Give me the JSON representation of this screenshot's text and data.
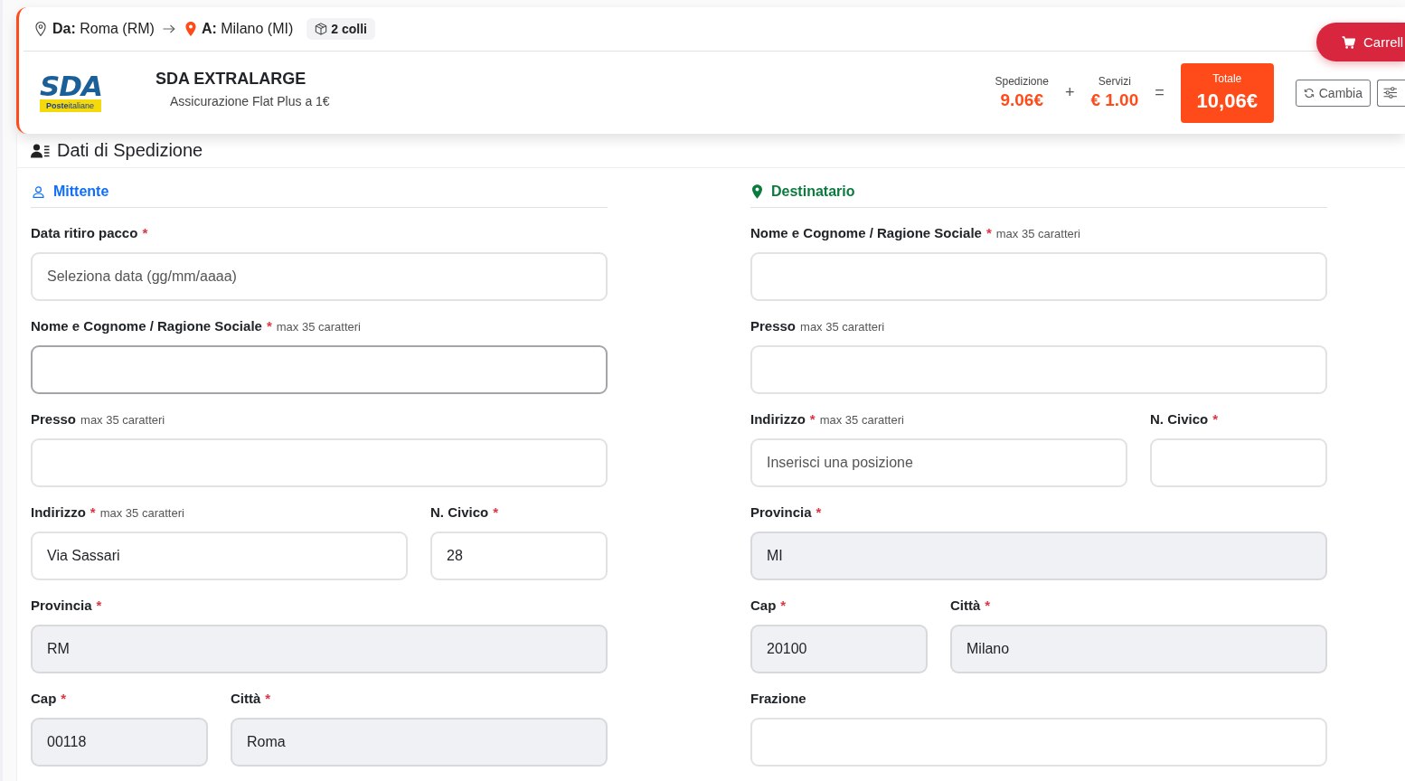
{
  "route": {
    "from": "**Da:** Roma (RM)",
    "to": "**A:** Milano (MI)",
    "packages": "2 colli"
  },
  "cart_button": {
    "label": "Carrell"
  },
  "carrier": {
    "logo": {
      "wordmark": "SDA",
      "tagline": "**Poste**italiane"
    },
    "service": "SDA EXTRALARGE",
    "option": "Assicurazione Flat Plus a 1€"
  },
  "price": {
    "items": [
      {
        "label": "Spedizione",
        "value": "9.06€"
      },
      {
        "label": "Servizi",
        "value": "€ 1.00"
      }
    ],
    "operators": [
      "+",
      "="
    ],
    "total": {
      "label": "Totale",
      "value": "10,06€"
    }
  },
  "actions": [
    {
      "kind": "change",
      "label": "Cambia"
    },
    {
      "kind": "options"
    }
  ],
  "section": {
    "title": "Dati di Spedizione"
  },
  "columns": [
    {
      "kind": "sender",
      "title": "Mittente",
      "color": "#0d6efd",
      "rows": [
        {
          "kind": "single",
          "fields": [
            {
              "label": "Data ritiro pacco",
              "required_mark": "*",
              "placeholder": "Seleziona data (gg/mm/aaaa)",
              "readonly": false,
              "focused": false
            }
          ]
        },
        {
          "kind": "single",
          "fields": [
            {
              "label": "Nome e Cognome / Ragione Sociale",
              "required_mark": "*",
              "hint": "max 35 caratteri",
              "readonly": false,
              "focused": true
            }
          ]
        },
        {
          "kind": "single",
          "fields": [
            {
              "label": "Presso",
              "hint": "max 35 caratteri",
              "readonly": false,
              "focused": false
            }
          ]
        },
        {
          "kind": "street",
          "fields": [
            {
              "label": "Indirizzo",
              "required_mark": "*",
              "hint": "max 35 caratteri",
              "value": "Via Sassari",
              "readonly": false,
              "focused": false
            },
            {
              "label": "N. Civico",
              "required_mark": "*",
              "value": "28",
              "readonly": false,
              "focused": false
            }
          ]
        },
        {
          "kind": "single",
          "fields": [
            {
              "label": "Provincia",
              "required_mark": "*",
              "value": "RM",
              "readonly": true,
              "focused": false
            }
          ]
        },
        {
          "kind": "locality",
          "fields": [
            {
              "label": "Cap",
              "required_mark": "*",
              "value": "00118",
              "readonly": true,
              "focused": false
            },
            {
              "label": "Città",
              "required_mark": "*",
              "value": "Roma",
              "readonly": true,
              "focused": false
            }
          ]
        }
      ]
    },
    {
      "kind": "recipient",
      "title": "Destinatario",
      "color": "#0b7a3e",
      "rows": [
        {
          "kind": "single",
          "fields": [
            {
              "label": "Nome e Cognome / Ragione Sociale",
              "required_mark": "*",
              "hint": "max 35 caratteri",
              "readonly": false,
              "focused": false
            }
          ]
        },
        {
          "kind": "single",
          "fields": [
            {
              "label": "Presso",
              "hint": "max 35 caratteri",
              "readonly": false,
              "focused": false
            }
          ]
        },
        {
          "kind": "street",
          "fields": [
            {
              "label": "Indirizzo",
              "required_mark": "*",
              "hint": "max 35 caratteri",
              "placeholder": "Inserisci una posizione",
              "readonly": false,
              "focused": false
            },
            {
              "label": "N. Civico",
              "required_mark": "*",
              "readonly": false,
              "focused": false
            }
          ]
        },
        {
          "kind": "single",
          "fields": [
            {
              "label": "Provincia",
              "required_mark": "*",
              "value": "MI",
              "readonly": true,
              "focused": false
            }
          ]
        },
        {
          "kind": "locality",
          "fields": [
            {
              "label": "Cap",
              "required_mark": "*",
              "value": "20100",
              "readonly": true,
              "focused": false
            },
            {
              "label": "Città",
              "required_mark": "*",
              "value": "Milano",
              "readonly": true,
              "focused": false
            }
          ]
        },
        {
          "kind": "single",
          "fields": [
            {
              "label": "Frazione",
              "readonly": false,
              "focused": false
            }
          ]
        }
      ]
    }
  ]
}
